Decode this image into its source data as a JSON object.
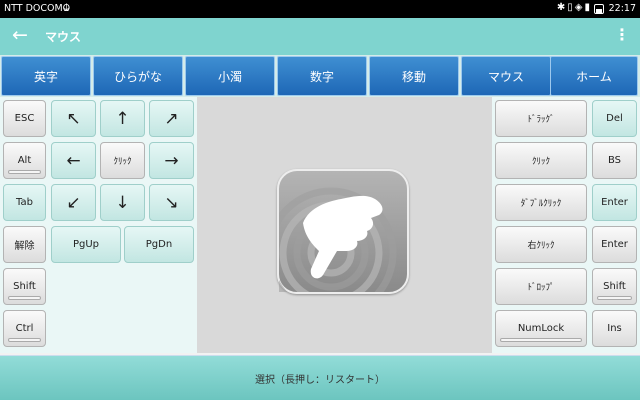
{
  "status_bar": {
    "carrier": "NTT DOCOMO",
    "time": "22:17"
  },
  "app_bar": {
    "title": "マウス"
  },
  "tabs": [
    "英字",
    "ひらがな",
    "小濁",
    "数字",
    "移動",
    "マウス",
    "ホーム"
  ],
  "left_panel": {
    "esc": "ESC",
    "alt": "Alt",
    "tab": "Tab",
    "kaijo": "解除",
    "shift": "Shift",
    "ctrl": "Ctrl",
    "arrows": [
      "↖",
      "↑",
      "↗",
      "←",
      "ｸﾘｯｸ",
      "→",
      "↙",
      "↓",
      "↘"
    ],
    "pgup": "PgUp",
    "pgdn": "PgDn"
  },
  "right_panel": {
    "mouse_actions": [
      "ﾄﾞﾗｯｸﾞ",
      "ｸﾘｯｸ",
      "ﾀﾞﾌﾞﾙｸﾘｯｸ",
      "右ｸﾘｯｸ",
      "ﾄﾞﾛｯﾌﾟ",
      "NumLock"
    ],
    "side_keys": [
      "Del",
      "BS",
      "Enter",
      "Enter",
      "Shift",
      "Ins"
    ]
  },
  "bottom_bar": {
    "label": "選択（長押し：リスタート）"
  },
  "colors": {
    "accent": "#7fd4cf",
    "tab": "#2a76c4"
  }
}
